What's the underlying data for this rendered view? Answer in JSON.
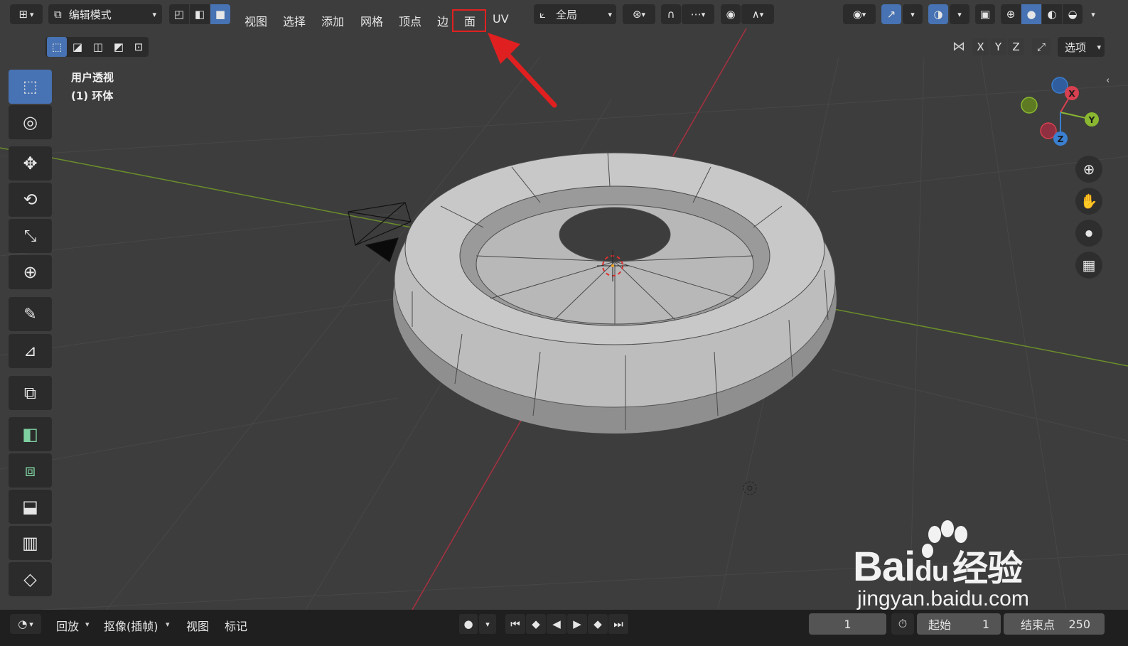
{
  "header": {
    "mode_label": "编辑模式",
    "menus": [
      "视图",
      "选择",
      "添加",
      "网格",
      "顶点",
      "边",
      "面",
      "UV"
    ],
    "highlighted_menu": "面",
    "orientation_label": "全局",
    "options_label": "选项",
    "axes": [
      "X",
      "Y",
      "Z"
    ]
  },
  "viewport": {
    "view_name": "用户透视",
    "object_name": "(1) 环体"
  },
  "gizmo": {
    "x": "X",
    "y": "Y",
    "z": "Z"
  },
  "timeline": {
    "playback_label": "回放",
    "keying_label": "抠像(插帧)",
    "view_label": "视图",
    "marker_label": "标记",
    "current_frame": "1",
    "start_label": "起始",
    "start_value": "1",
    "end_label": "结束点",
    "end_value": "250"
  },
  "watermark": {
    "brand_a": "Bai",
    "brand_b": "du",
    "brand_c": "经验",
    "url": "jingyan.baidu.com"
  },
  "colors": {
    "accent": "#4772b3",
    "highlight_red": "#e02020",
    "x_axis": "#d64050",
    "y_axis": "#8ab830",
    "z_axis": "#3a7fd0"
  }
}
